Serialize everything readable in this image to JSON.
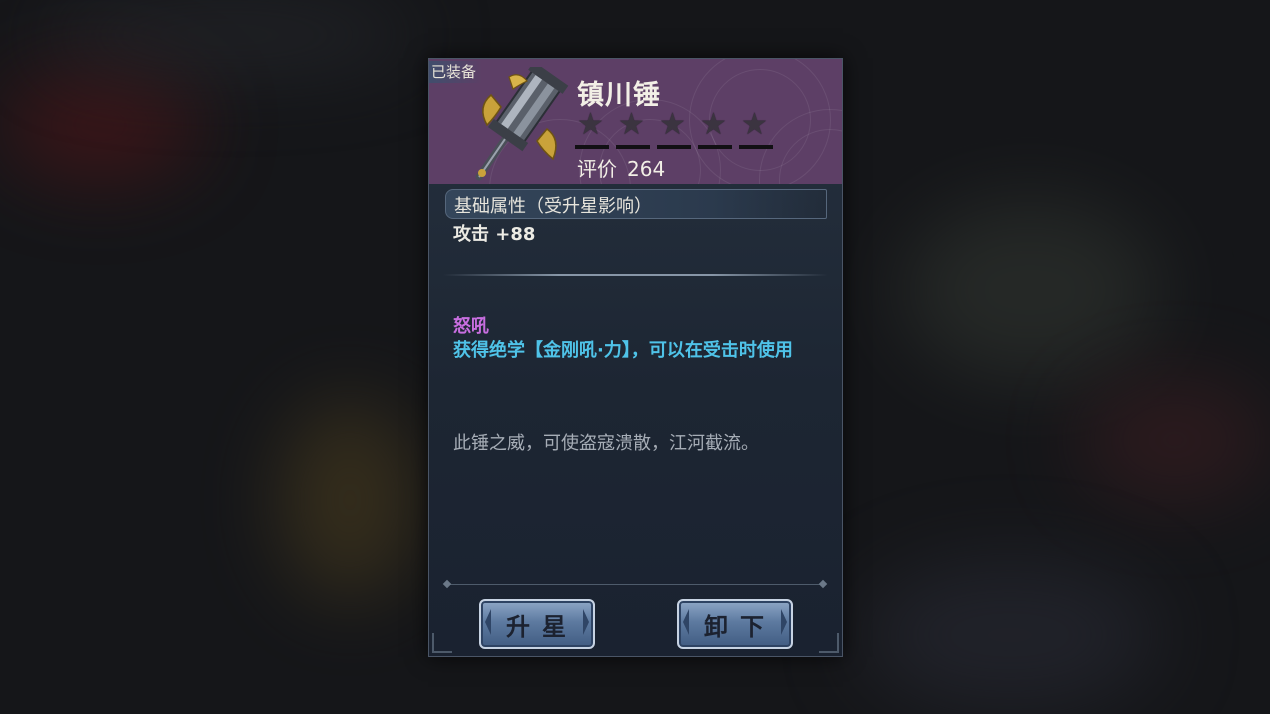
{
  "item": {
    "equipped_tag": "已装备",
    "name": "镇川锤",
    "star_count_max": 5,
    "star_count_filled": 0,
    "rating_label": "评价",
    "rating_value": "264"
  },
  "attributes": {
    "header": "基础属性（受升星影响）",
    "value": "攻击 +88"
  },
  "skill": {
    "name": "怒吼",
    "description": "获得绝学【金刚吼·力】，可以在受击时使用"
  },
  "flavor_text": "此锤之威，可使盗寇溃散，江河截流。",
  "buttons": {
    "upgrade_star": "升星",
    "unequip": "卸下"
  },
  "colors": {
    "header_bg": "#5d3f66",
    "skill_name": "#c86ee0",
    "skill_desc": "#4fc3e8",
    "button": "#5d7aa0"
  },
  "icons": {
    "weapon": "hammer-weapon-icon",
    "star": "star-icon"
  }
}
